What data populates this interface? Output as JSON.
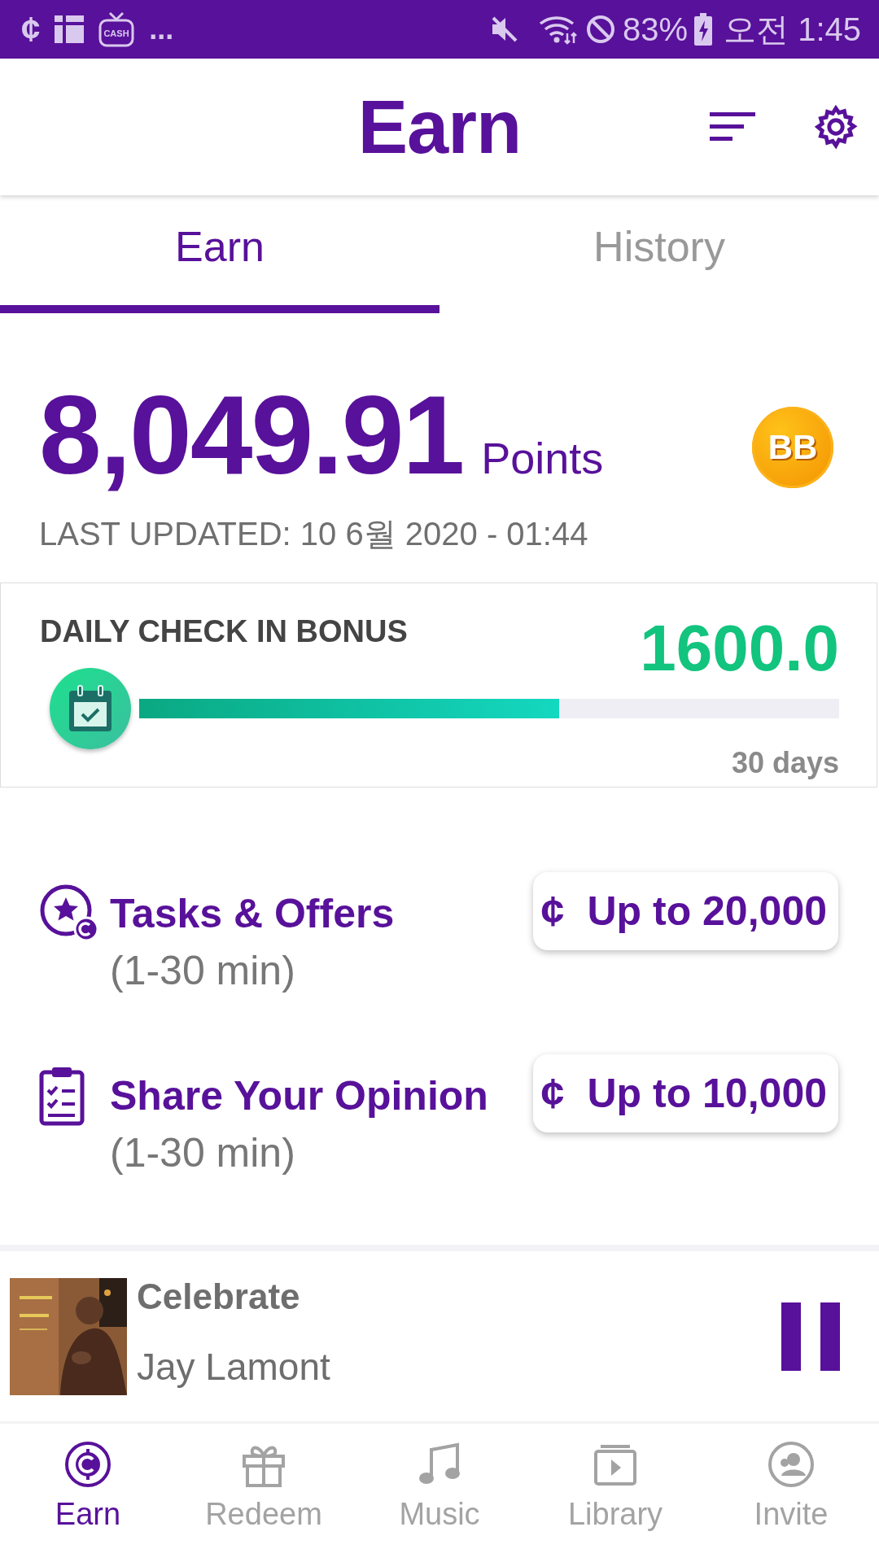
{
  "status_bar": {
    "cent_icon": "¢",
    "cash_label": "CASH",
    "more": "...",
    "battery": "83%",
    "time": "오전 1:45"
  },
  "header": {
    "title": "Earn"
  },
  "tabs": [
    {
      "label": "Earn",
      "selected": true
    },
    {
      "label": "History",
      "selected": false
    }
  ],
  "balance": {
    "amount": "8,049.91",
    "unit": "Points",
    "badge": "BB",
    "last_updated": "LAST UPDATED: 10 6월 2020 - 01:44"
  },
  "daily_bonus": {
    "title": "DAILY CHECK IN BONUS",
    "amount": "1600.0",
    "level": 0.6,
    "duration": "30 days"
  },
  "offers": [
    {
      "kind": "tasks",
      "title": "Tasks & Offers",
      "duration": "(1-30 min)",
      "currency": "¢",
      "reward": "Up to 20,000"
    },
    {
      "kind": "survey",
      "title": "Share Your Opinion",
      "duration": "(1-30 min)",
      "currency": "¢",
      "reward": "Up to 10,000"
    }
  ],
  "now_playing": {
    "title": "Celebrate",
    "artist": "Jay Lamont",
    "playing": true
  },
  "bottom_nav": [
    {
      "kind": "earn",
      "label": "Earn",
      "selected": true
    },
    {
      "kind": "redeem",
      "label": "Redeem",
      "selected": false
    },
    {
      "kind": "music",
      "label": "Music",
      "selected": false
    },
    {
      "kind": "library",
      "label": "Library",
      "selected": false
    },
    {
      "kind": "invite",
      "label": "Invite",
      "selected": false
    }
  ]
}
